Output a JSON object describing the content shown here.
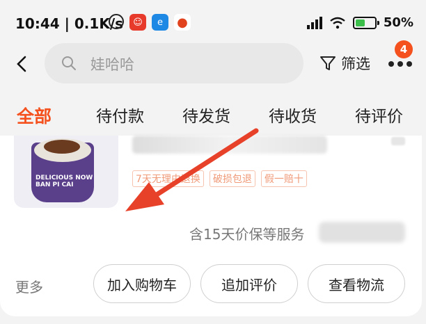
{
  "status_bar": {
    "time": "10:44 | 0.1K/s",
    "battery": "50%",
    "battery_fraction": 0.5
  },
  "search": {
    "placeholder": "娃哈哈",
    "filter_label": "筛选",
    "more_badge": "4"
  },
  "tabs": [
    {
      "label": "全部",
      "active": true
    },
    {
      "label": "待付款",
      "active": false
    },
    {
      "label": "待发货",
      "active": false
    },
    {
      "label": "待收货",
      "active": false
    },
    {
      "label": "待评价",
      "active": false
    }
  ],
  "order": {
    "product_image_text": "DELICIOUS NOW\nBAN PI CAI",
    "tags": [
      "7天无理由退换",
      "破损包退",
      "假一赔十"
    ],
    "service_text": "含15天价保等服务",
    "more_label": "更多",
    "buttons": [
      "加入购物车",
      "追加评价",
      "查看物流"
    ]
  },
  "colors": {
    "accent": "#f4511e",
    "arrow": "#e8412a"
  }
}
